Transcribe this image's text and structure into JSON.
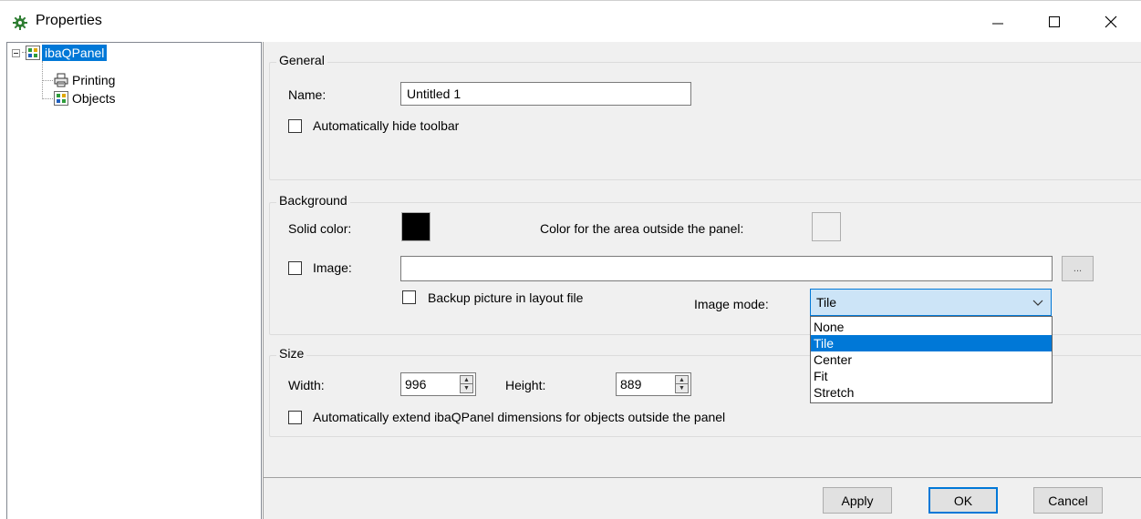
{
  "window": {
    "title": "Properties",
    "icon": "gear-icon",
    "controls": [
      "minimize-icon",
      "maximize-icon",
      "close-icon"
    ]
  },
  "tree": {
    "root": {
      "label": "ibaQPanel",
      "selected": true,
      "expanded": true
    },
    "children": [
      {
        "label": "Printing",
        "icon": "printer-icon"
      },
      {
        "label": "Objects",
        "icon": "panel-icon"
      }
    ]
  },
  "general": {
    "title": "General",
    "name_label": "Name:",
    "name_value": "Untitled 1",
    "hide_toolbar_label": "Automatically hide toolbar",
    "hide_toolbar_checked": false
  },
  "background": {
    "title": "Background",
    "solid_color_label": "Solid color:",
    "solid_color": "#000000",
    "outside_color_label": "Color for the area outside the panel:",
    "outside_color": "#f0f0f0",
    "image_label": "Image:",
    "image_checked": false,
    "image_path": "",
    "browse_label": "...",
    "backup_label": "Backup picture in layout file",
    "backup_checked": false,
    "image_mode_label": "Image mode:",
    "image_mode_value": "Tile",
    "image_mode_options": [
      "None",
      "Tile",
      "Center",
      "Fit",
      "Stretch"
    ]
  },
  "size": {
    "title": "Size",
    "width_label": "Width:",
    "width_value": "996",
    "height_label": "Height:",
    "height_value": "889",
    "extend_label": "Automatically extend ibaQPanel dimensions for objects outside the panel",
    "extend_checked": false
  },
  "footer": {
    "apply_label": "Apply",
    "ok_label": "OK",
    "cancel_label": "Cancel"
  },
  "colors": {
    "accent": "#0078d7",
    "dialog_bg": "#f0f0f0"
  }
}
